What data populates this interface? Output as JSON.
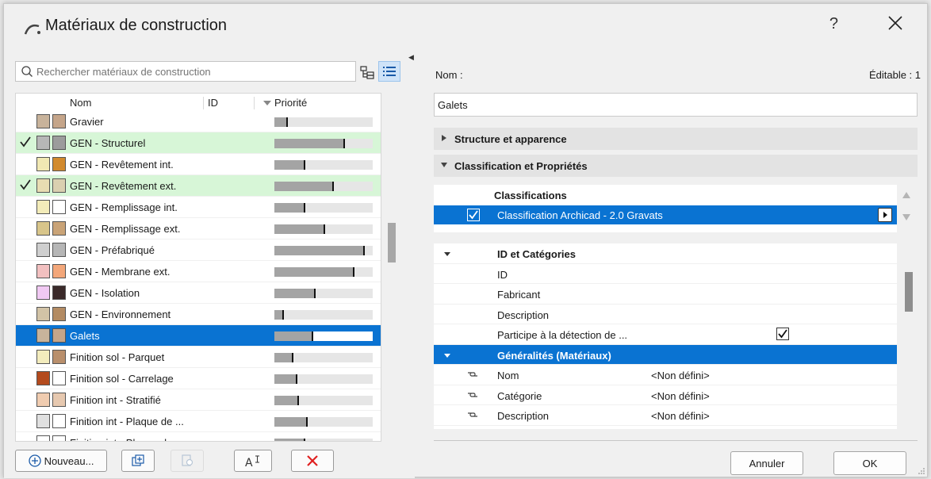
{
  "window": {
    "title": "Matériaux de construction",
    "help_label": "?"
  },
  "search": {
    "placeholder": "Rechercher matériaux de construction"
  },
  "table": {
    "headers": {
      "name": "Nom",
      "id": "ID",
      "priority": "Priorité"
    },
    "rows": [
      {
        "name": "Gravier",
        "swatch1": "#c8b39b",
        "swatch2": "#c5a58a",
        "checked": false,
        "selected": false,
        "green": false,
        "priority": 0.12
      },
      {
        "name": "GEN - Structurel",
        "swatch1": "#b7b7b7",
        "swatch2": "#9c9c9c",
        "checked": true,
        "selected": false,
        "green": true,
        "priority": 0.7
      },
      {
        "name": "GEN - Revêtement int.",
        "swatch1": "#f1e8b3",
        "swatch2": "#d28a2e",
        "checked": false,
        "selected": false,
        "green": false,
        "priority": 0.3
      },
      {
        "name": "GEN - Revêtement ext.",
        "swatch1": "#e8dcb2",
        "swatch2": "#dad0b0",
        "checked": true,
        "selected": false,
        "green": true,
        "priority": 0.59
      },
      {
        "name": "GEN - Remplissage int.",
        "swatch1": "#f3ecb9",
        "swatch2": "#ffffff",
        "checked": false,
        "selected": false,
        "green": false,
        "priority": 0.3
      },
      {
        "name": "GEN - Remplissage ext.",
        "swatch1": "#d8c58a",
        "swatch2": "#c9a377",
        "checked": false,
        "selected": false,
        "green": false,
        "priority": 0.5
      },
      {
        "name": "GEN - Préfabriqué",
        "swatch1": "#cfcfcf",
        "swatch2": "#b6b6b6",
        "checked": false,
        "selected": false,
        "green": false,
        "priority": 0.9
      },
      {
        "name": "GEN - Membrane ext.",
        "swatch1": "#f2c0c0",
        "swatch2": "#f3a77a",
        "checked": false,
        "selected": false,
        "green": false,
        "priority": 0.8
      },
      {
        "name": "GEN - Isolation",
        "swatch1": "#f1c9f3",
        "swatch2": "#3a2a2a",
        "checked": false,
        "selected": false,
        "green": false,
        "priority": 0.4
      },
      {
        "name": "GEN - Environnement",
        "swatch1": "#d2c3a6",
        "swatch2": "#b38b63",
        "checked": false,
        "selected": false,
        "green": false,
        "priority": 0.08
      },
      {
        "name": "Galets",
        "swatch1": "#c8b39b",
        "swatch2": "#c5a58a",
        "checked": false,
        "selected": true,
        "green": false,
        "priority": 0.38
      },
      {
        "name": "Finition sol - Parquet",
        "swatch1": "#f3ecbd",
        "swatch2": "#b98f6c",
        "checked": false,
        "selected": false,
        "green": false,
        "priority": 0.18
      },
      {
        "name": "Finition sol - Carrelage",
        "swatch1": "#b34a1d",
        "swatch2": "#ffffff",
        "checked": false,
        "selected": false,
        "green": false,
        "priority": 0.22
      },
      {
        "name": "Finition int - Stratifié",
        "swatch1": "#f0ccb0",
        "swatch2": "#e7c9b0",
        "checked": false,
        "selected": false,
        "green": false,
        "priority": 0.23
      },
      {
        "name": "Finition int - Plaque de ...",
        "swatch1": "#e0e0e0",
        "swatch2": "#ffffff",
        "checked": false,
        "selected": false,
        "green": false,
        "priority": 0.32
      },
      {
        "name": "Finition int - Plaque de ...",
        "swatch1": "#ffffff",
        "swatch2": "#ffffff",
        "checked": false,
        "selected": false,
        "green": false,
        "priority": 0.3
      }
    ]
  },
  "toolbar": {
    "new_label": "Nouveau..."
  },
  "details": {
    "name_label": "Nom :",
    "editable_label": "Éditable : 1",
    "name_value": "Galets",
    "section_structure": "Structure et apparence",
    "section_classification": "Classification et Propriétés",
    "classifications_header": "Classifications",
    "classification_row": "Classification Archicad - 2.0  Gravats",
    "props": {
      "group1": "ID et Catégories",
      "id_label": "ID",
      "manufacturer_label": "Fabricant",
      "description_label": "Description",
      "detection_label": "Participe à la détection de ...",
      "group2": "Généralités (Matériaux)",
      "gen_name_label": "Nom",
      "gen_name_value": "<Non défini>",
      "gen_category_label": "Catégorie",
      "gen_category_value": "<Non défini>",
      "gen_description_label": "Description",
      "gen_description_value": "<Non défini>"
    }
  },
  "footer": {
    "cancel_label": "Annuler",
    "ok_label": "OK"
  },
  "colors": {
    "selection": "#0a73d2",
    "green_row": "#d7f6d7",
    "delete_red": "#e02020"
  }
}
